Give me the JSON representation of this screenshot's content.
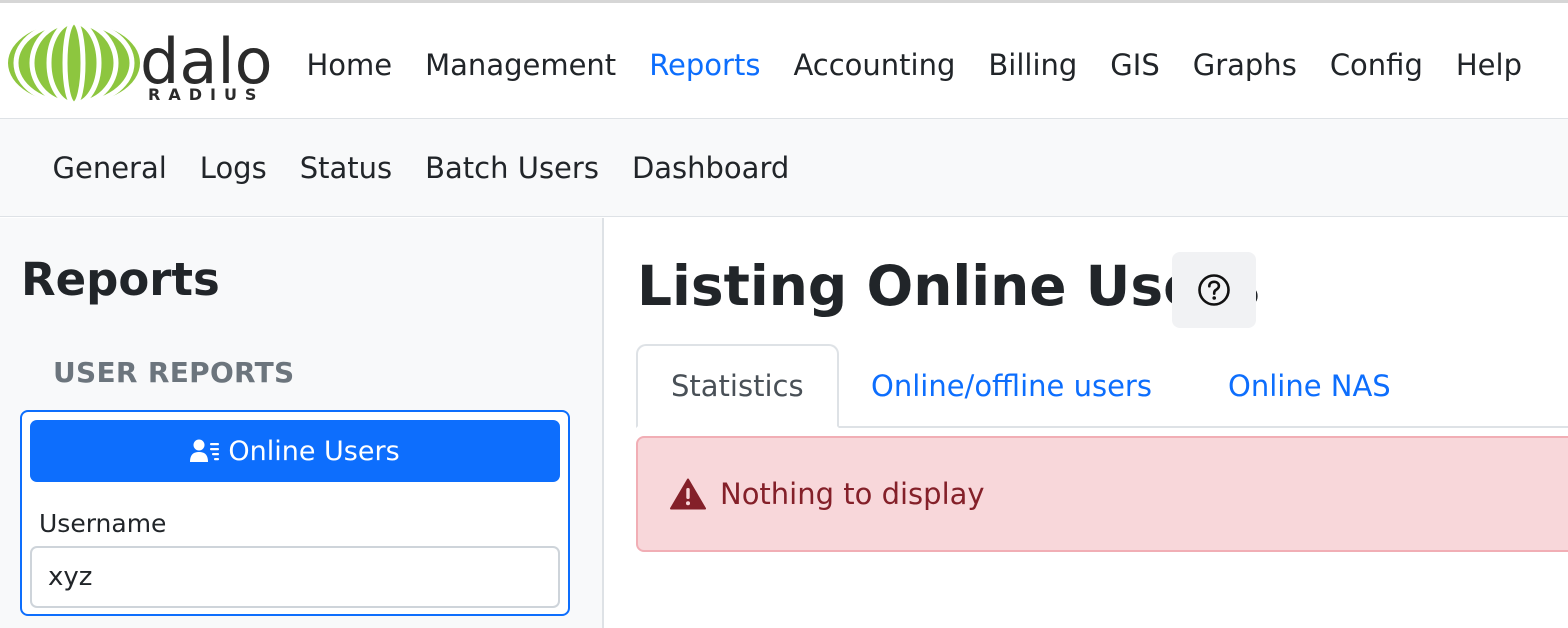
{
  "brand": {
    "logo_main": "dalo",
    "logo_sub": "RADIUS"
  },
  "topnav": {
    "items": [
      {
        "label": "Home",
        "active": false
      },
      {
        "label": "Management",
        "active": false
      },
      {
        "label": "Reports",
        "active": true
      },
      {
        "label": "Accounting",
        "active": false
      },
      {
        "label": "Billing",
        "active": false
      },
      {
        "label": "GIS",
        "active": false
      },
      {
        "label": "Graphs",
        "active": false
      },
      {
        "label": "Config",
        "active": false
      },
      {
        "label": "Help",
        "active": false
      }
    ]
  },
  "subnav": {
    "items": [
      {
        "label": "General"
      },
      {
        "label": "Logs"
      },
      {
        "label": "Status"
      },
      {
        "label": "Batch Users"
      },
      {
        "label": "Dashboard"
      }
    ]
  },
  "sidebar": {
    "title": "Reports",
    "section": "USER REPORTS",
    "button_label": "Online Users",
    "button_icon": "person-lines-icon",
    "field_label": "Username",
    "field_value": "xyz"
  },
  "main": {
    "title": "Listing Online Users",
    "help_icon": "question-circle-icon",
    "tabs": [
      {
        "label": "Statistics",
        "active": true
      },
      {
        "label": "Online/offline users",
        "active": false
      },
      {
        "label": "Online NAS",
        "active": false
      }
    ],
    "alert": {
      "icon": "warning-triangle-icon",
      "text": "Nothing to display"
    }
  },
  "colors": {
    "primary": "#0d6efd",
    "logo_green": "#8dc63f",
    "alert_bg": "#f8d7da",
    "alert_text": "#842029",
    "muted": "#6c757d"
  }
}
